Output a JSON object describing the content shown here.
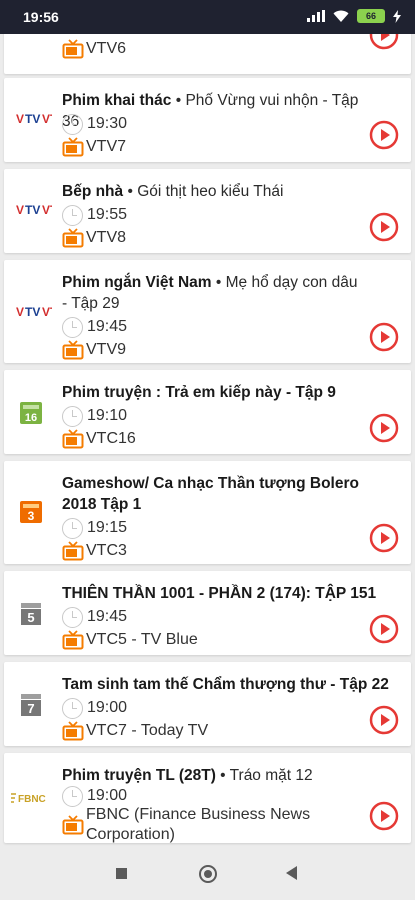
{
  "status": {
    "time": "19:56",
    "battery": "66"
  },
  "items": [
    {
      "logo": "",
      "title_bold": "",
      "title_rest": "",
      "time": "",
      "channel": "VTV6"
    },
    {
      "logo": "VTV7",
      "title_bold": "Phim khai thác",
      "title_rest": " • Phố Vừng vui nhộn - Tập 36",
      "time": "19:30",
      "channel": "VTV7"
    },
    {
      "logo": "VTV8",
      "title_bold": "Bếp nhà",
      "title_rest": " • Gói thịt heo kiểu Thái",
      "time": "19:55",
      "channel": "VTV8"
    },
    {
      "logo": "VTV9",
      "title_bold": "Phim ngắn Việt Nam",
      "title_rest": " • Mẹ hổ dạy con dâu - Tập 29",
      "time": "19:45",
      "channel": "VTV9"
    },
    {
      "logo": "16",
      "title_bold": "Phim truyện : Trả em kiếp này - Tập 9",
      "title_rest": "",
      "time": "19:10",
      "channel": "VTC16"
    },
    {
      "logo": "3",
      "title_bold": "Gameshow/ Ca nhạc Thần tượng Bolero 2018 Tập 1",
      "title_rest": "",
      "time": "19:15",
      "channel": "VTC3"
    },
    {
      "logo": "5",
      "title_bold": "THIÊN THẦN 1001 - PHẦN 2 (174): TẬP 151",
      "title_rest": "",
      "time": "19:45",
      "channel": "VTC5 - TV Blue"
    },
    {
      "logo": "7",
      "title_bold": "Tam sinh tam thế Chẩm thượng thư - Tập 22",
      "title_rest": "",
      "time": "19:00",
      "channel": "VTC7 - Today TV"
    },
    {
      "logo": "FBNC",
      "title_bold": "Phim truyện TL (28T)",
      "title_rest": " • Tráo mặt 12",
      "time": "19:00",
      "channel": "FBNC (Finance Business News Corporation)"
    }
  ],
  "colors": {
    "accent": "#e53935",
    "tv_icon": "#f57c00",
    "statusbar": "#1f2230",
    "vtv_blue": "#1b3f91",
    "vtc16_green": "#7cb342",
    "vtc3_orange": "#ef6c00",
    "vtc_gray": "#777777",
    "fbnc_gold": "#c9a227"
  }
}
